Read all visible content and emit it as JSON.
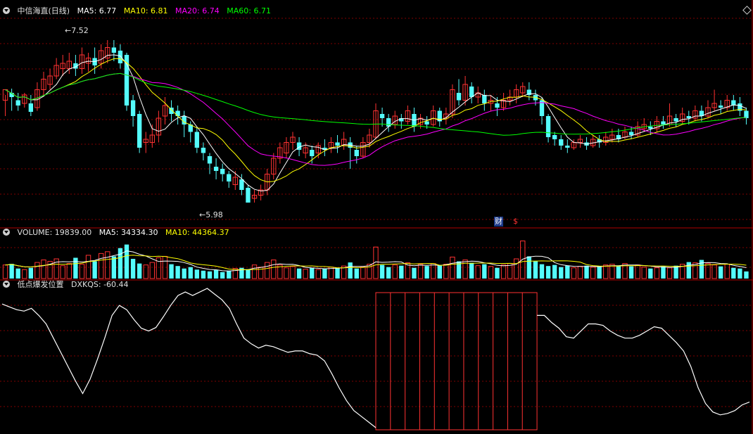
{
  "price_header": {
    "stock_name": "中信海直(日线)",
    "ma5": "MA5: 6.77",
    "ma10": "MA10: 6.81",
    "ma20": "MA20: 6.74",
    "ma60": "MA60: 6.71"
  },
  "volume_header": {
    "volume": "VOLUME: 19839.00",
    "ma5": "MA5: 34334.30",
    "ma10": "MA10: 44364.37"
  },
  "indicator_header": {
    "name": "低点爆发位置",
    "value": "DXKQS: -60.44"
  },
  "markers": {
    "finance_label": "财",
    "dividend_label": "$",
    "high_label": "7.52",
    "low_label": "5.98"
  },
  "colors": {
    "up": "#ff3232",
    "down": "#54fcfc",
    "ma5": "#ffffff",
    "ma10": "#ffff00",
    "ma20": "#ff00ff",
    "ma60": "#00ff00",
    "grid": "#800000",
    "indicator_line": "#ffffff",
    "indicator_box": "#ff3232"
  },
  "chart_data": [
    {
      "type": "candlestick",
      "title": "中信海直(日线)",
      "ylim": [
        5.9,
        7.7
      ],
      "high": 7.52,
      "low": 5.98,
      "candles": [
        [
          6.95,
          7.05,
          6.8,
          7.0
        ],
        [
          7.02,
          6.98,
          6.85,
          7.06
        ],
        [
          6.95,
          6.9,
          6.85,
          7.02
        ],
        [
          6.92,
          7.0,
          6.88,
          7.02
        ],
        [
          6.92,
          6.84,
          6.8,
          7.0
        ],
        [
          6.88,
          7.05,
          6.85,
          7.12
        ],
        [
          7.05,
          7.15,
          7.0,
          7.22
        ],
        [
          7.1,
          7.18,
          7.05,
          7.25
        ],
        [
          7.18,
          7.28,
          7.15,
          7.35
        ],
        [
          7.25,
          7.3,
          7.18,
          7.38
        ],
        [
          7.25,
          7.32,
          7.2,
          7.4
        ],
        [
          7.3,
          7.25,
          7.18,
          7.38
        ],
        [
          7.25,
          7.38,
          7.2,
          7.45
        ],
        [
          7.3,
          7.35,
          7.22,
          7.4
        ],
        [
          7.35,
          7.28,
          7.2,
          7.45
        ],
        [
          7.3,
          7.42,
          7.25,
          7.48
        ],
        [
          7.35,
          7.45,
          7.3,
          7.52
        ],
        [
          7.45,
          7.4,
          7.32,
          7.52
        ],
        [
          7.42,
          7.3,
          7.25,
          7.48
        ],
        [
          7.38,
          6.9,
          6.85,
          7.4
        ],
        [
          6.95,
          6.8,
          6.7,
          7.0
        ],
        [
          6.82,
          6.5,
          6.45,
          6.85
        ],
        [
          6.55,
          6.58,
          6.45,
          6.65
        ],
        [
          6.55,
          6.62,
          6.5,
          6.72
        ],
        [
          6.62,
          6.78,
          6.55,
          6.85
        ],
        [
          6.8,
          6.9,
          6.72,
          6.98
        ],
        [
          6.88,
          6.82,
          6.75,
          6.95
        ],
        [
          6.85,
          6.8,
          6.72,
          6.9
        ],
        [
          6.8,
          6.72,
          6.6,
          6.85
        ],
        [
          6.72,
          6.65,
          6.55,
          6.75
        ],
        [
          6.65,
          6.5,
          6.45,
          6.7
        ],
        [
          6.5,
          6.45,
          6.38,
          6.55
        ],
        [
          6.42,
          6.35,
          6.25,
          6.45
        ],
        [
          6.32,
          6.28,
          6.2,
          6.4
        ],
        [
          6.3,
          6.25,
          6.18,
          6.35
        ],
        [
          6.25,
          6.18,
          6.12,
          6.28
        ],
        [
          6.15,
          6.22,
          6.1,
          6.28
        ],
        [
          6.2,
          6.1,
          6.05,
          6.25
        ],
        [
          6.12,
          5.98,
          5.98,
          6.15
        ],
        [
          6.02,
          6.05,
          5.98,
          6.1
        ],
        [
          6.05,
          6.1,
          6.0,
          6.15
        ],
        [
          6.1,
          6.25,
          6.05,
          6.3
        ],
        [
          6.25,
          6.4,
          6.2,
          6.45
        ],
        [
          6.4,
          6.5,
          6.35,
          6.55
        ],
        [
          6.45,
          6.55,
          6.4,
          6.6
        ],
        [
          6.55,
          6.6,
          6.48,
          6.65
        ],
        [
          6.55,
          6.48,
          6.42,
          6.6
        ],
        [
          6.45,
          6.5,
          6.4,
          6.55
        ],
        [
          6.48,
          6.42,
          6.35,
          6.52
        ],
        [
          6.45,
          6.52,
          6.4,
          6.55
        ],
        [
          6.5,
          6.48,
          6.42,
          6.58
        ],
        [
          6.5,
          6.55,
          6.45,
          6.6
        ],
        [
          6.55,
          6.52,
          6.45,
          6.62
        ],
        [
          6.52,
          6.58,
          6.48,
          6.65
        ],
        [
          6.55,
          6.5,
          6.3,
          6.6
        ],
        [
          6.48,
          6.42,
          6.35,
          6.52
        ],
        [
          6.42,
          6.55,
          6.4,
          6.6
        ],
        [
          6.55,
          6.62,
          6.5,
          6.68
        ],
        [
          6.6,
          6.85,
          6.58,
          6.92
        ],
        [
          6.82,
          6.78,
          6.7,
          6.88
        ],
        [
          6.78,
          6.7,
          6.65,
          6.82
        ],
        [
          6.72,
          6.8,
          6.68,
          6.85
        ],
        [
          6.78,
          6.75,
          6.68,
          6.82
        ],
        [
          6.75,
          6.85,
          6.72,
          6.9
        ],
        [
          6.82,
          6.7,
          6.65,
          6.88
        ],
        [
          6.72,
          6.78,
          6.68,
          6.82
        ],
        [
          6.75,
          6.72,
          6.68,
          6.8
        ],
        [
          6.72,
          6.85,
          6.7,
          6.9
        ],
        [
          6.85,
          6.75,
          6.7,
          6.88
        ],
        [
          6.78,
          6.82,
          6.72,
          6.88
        ],
        [
          6.82,
          7.05,
          6.78,
          7.1
        ],
        [
          7.02,
          6.95,
          6.9,
          7.15
        ],
        [
          6.95,
          7.1,
          6.9,
          7.18
        ],
        [
          7.08,
          6.98,
          6.92,
          7.12
        ],
        [
          6.98,
          7.02,
          6.92,
          7.08
        ],
        [
          7.0,
          6.92,
          6.85,
          7.05
        ],
        [
          6.92,
          6.95,
          6.85,
          7.0
        ],
        [
          6.92,
          6.88,
          6.8,
          6.98
        ],
        [
          6.88,
          6.95,
          6.85,
          7.02
        ],
        [
          6.95,
          6.98,
          6.9,
          7.05
        ],
        [
          6.98,
          7.05,
          6.92,
          7.1
        ],
        [
          7.02,
          7.08,
          6.98,
          7.12
        ],
        [
          7.05,
          7.0,
          6.95,
          7.12
        ],
        [
          7.0,
          6.95,
          6.9,
          7.05
        ],
        [
          6.95,
          6.8,
          6.72,
          6.98
        ],
        [
          6.8,
          6.6,
          6.55,
          6.82
        ],
        [
          6.62,
          6.58,
          6.52,
          6.65
        ],
        [
          6.58,
          6.52,
          6.48,
          6.62
        ],
        [
          6.52,
          6.5,
          6.45,
          6.58
        ],
        [
          6.5,
          6.55,
          6.48,
          6.58
        ],
        [
          6.55,
          6.58,
          6.5,
          6.62
        ],
        [
          6.55,
          6.52,
          6.48,
          6.6
        ],
        [
          6.52,
          6.58,
          6.5,
          6.62
        ],
        [
          6.58,
          6.55,
          6.5,
          6.62
        ],
        [
          6.55,
          6.6,
          6.52,
          6.65
        ],
        [
          6.58,
          6.62,
          6.55,
          6.68
        ],
        [
          6.62,
          6.58,
          6.55,
          6.68
        ],
        [
          6.6,
          6.65,
          6.58,
          6.7
        ],
        [
          6.65,
          6.62,
          6.58,
          6.7
        ],
        [
          6.62,
          6.7,
          6.6,
          6.75
        ],
        [
          6.68,
          6.72,
          6.65,
          6.78
        ],
        [
          6.7,
          6.68,
          6.62,
          6.75
        ],
        [
          6.68,
          6.75,
          6.65,
          6.8
        ],
        [
          6.75,
          6.72,
          6.68,
          6.8
        ],
        [
          6.72,
          6.8,
          6.7,
          6.92
        ],
        [
          6.78,
          6.75,
          6.7,
          6.82
        ],
        [
          6.75,
          6.82,
          6.72,
          6.88
        ],
        [
          6.8,
          6.78,
          6.72,
          6.85
        ],
        [
          6.78,
          6.85,
          6.75,
          6.9
        ],
        [
          6.85,
          6.8,
          6.75,
          6.9
        ],
        [
          6.8,
          6.88,
          6.78,
          6.95
        ],
        [
          6.88,
          6.92,
          6.85,
          7.05
        ],
        [
          6.9,
          6.88,
          6.82,
          6.95
        ],
        [
          6.88,
          6.95,
          6.85,
          7.0
        ],
        [
          6.95,
          6.9,
          6.85,
          7.0
        ],
        [
          6.92,
          6.85,
          6.8,
          6.98
        ],
        [
          6.85,
          6.78,
          6.72,
          6.88
        ]
      ],
      "ma_last": {
        "MA5": 6.77,
        "MA10": 6.81,
        "MA20": 6.74,
        "MA60": 6.71
      }
    },
    {
      "type": "bar",
      "title": "VOLUME",
      "ylim": [
        0,
        110000
      ],
      "values": [
        38000,
        41000,
        28000,
        25000,
        30000,
        45000,
        52000,
        48000,
        55000,
        36000,
        42000,
        58000,
        40000,
        65000,
        48000,
        70000,
        75000,
        62000,
        85000,
        95000,
        55000,
        42000,
        38000,
        45000,
        58000,
        62000,
        40000,
        35000,
        28000,
        32000,
        25000,
        22000,
        20000,
        24000,
        18000,
        22000,
        28000,
        30000,
        26000,
        38000,
        32000,
        45000,
        52000,
        38000,
        30000,
        34000,
        28000,
        26000,
        30000,
        25000,
        28000,
        32000,
        30000,
        35000,
        45000,
        28000,
        32000,
        40000,
        88000,
        38000,
        32000,
        38000,
        36000,
        44000,
        30000,
        40000,
        35000,
        42000,
        36000,
        40000,
        60000,
        48000,
        52000,
        44000,
        36000,
        40000,
        34000,
        30000,
        38000,
        42000,
        55000,
        105000,
        62000,
        48000,
        40000,
        35000,
        38000,
        32000,
        36000,
        30000,
        34000,
        36000,
        32000,
        34000,
        38000,
        40000,
        36000,
        42000,
        34000,
        38000,
        32000,
        28000,
        30000,
        34000,
        30000,
        36000,
        40000,
        46000,
        44000,
        52000,
        42000,
        38000,
        34000,
        40000,
        30000,
        28000,
        19839
      ],
      "ma5_last": 34334.3,
      "ma10_last": 44364.37
    },
    {
      "type": "line",
      "title": "低点爆发位置",
      "ylim": [
        -100,
        100
      ],
      "series": [
        {
          "name": "DXKQS",
          "values": [
            78,
            74,
            70,
            68,
            72,
            62,
            50,
            30,
            10,
            -10,
            -30,
            -48,
            -28,
            0,
            30,
            62,
            76,
            70,
            56,
            44,
            40,
            45,
            60,
            76,
            90,
            95,
            90,
            95,
            100,
            92,
            84,
            72,
            50,
            30,
            22,
            16,
            20,
            18,
            14,
            10,
            12,
            12,
            8,
            6,
            -2,
            -20,
            -40,
            -58,
            -72,
            -80,
            -88,
            -96,
            -105,
            -112,
            -118,
            -120,
            -115,
            -108,
            -100,
            -98,
            -102,
            -112,
            -118,
            -120,
            -105,
            -50,
            0,
            30,
            50,
            58,
            56,
            50,
            54,
            62,
            62,
            52,
            44,
            32,
            30,
            40,
            50,
            50,
            48,
            40,
            34,
            30,
            30,
            34,
            40,
            46,
            44,
            34,
            24,
            12,
            -10,
            -40,
            -62,
            -74,
            -78,
            -76,
            -72,
            -64,
            -60
          ],
          "last": -60.44
        }
      ],
      "signal_range": [
        51,
        73
      ]
    }
  ]
}
